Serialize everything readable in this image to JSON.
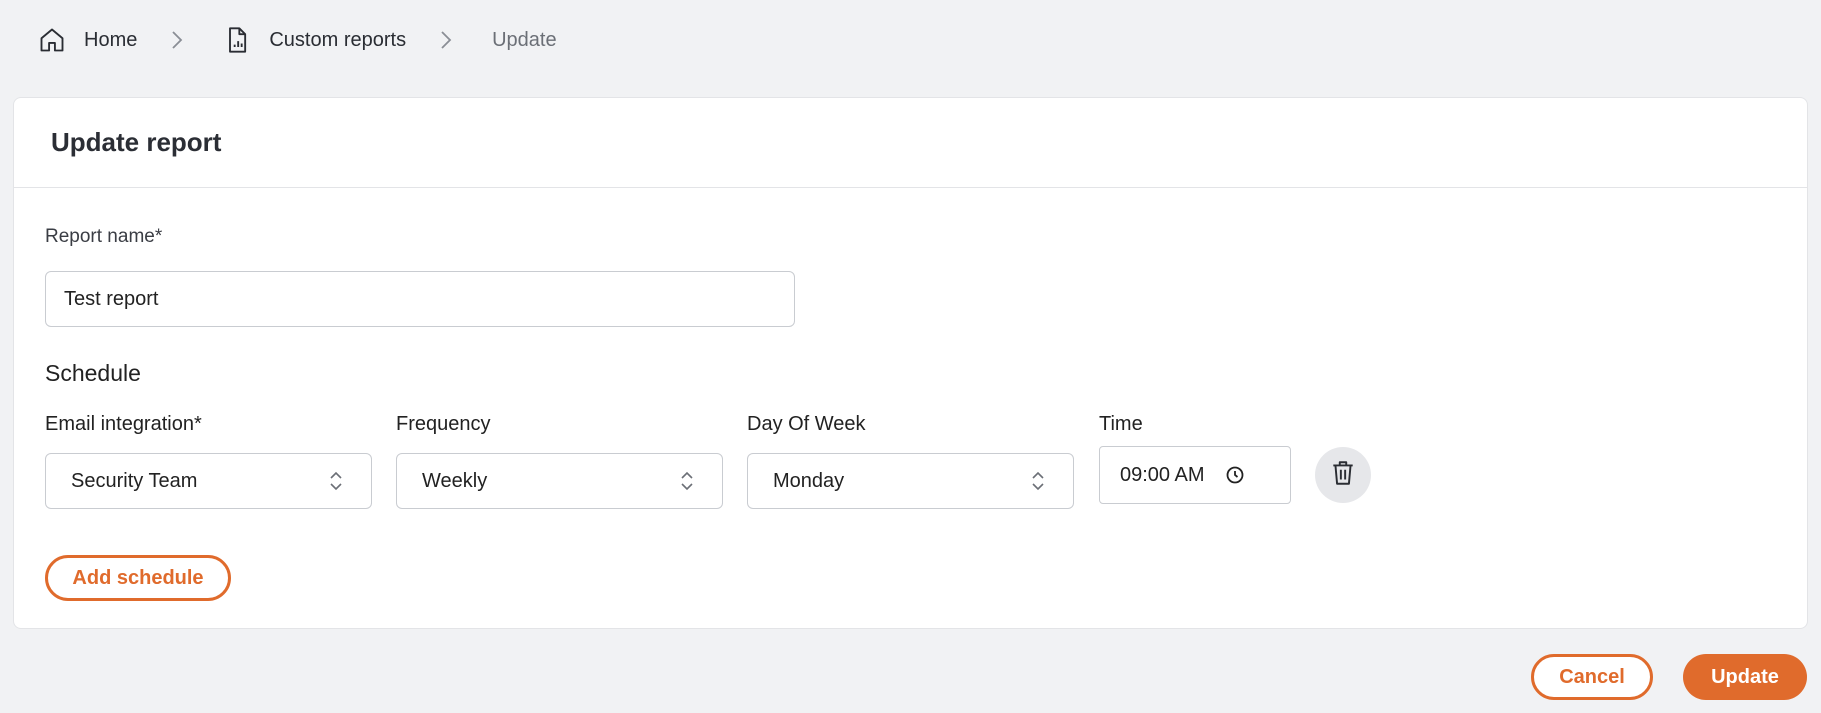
{
  "breadcrumb": {
    "home_label": "Home",
    "reports_label": "Custom reports",
    "current_label": "Update"
  },
  "card": {
    "title": "Update report"
  },
  "form": {
    "report_name_label": "Report name*",
    "report_name_value": "Test report",
    "schedule_title": "Schedule",
    "email_label": "Email integration*",
    "email_value": "Security Team",
    "frequency_label": "Frequency",
    "frequency_value": "Weekly",
    "day_label": "Day Of Week",
    "day_value": "Monday",
    "time_label": "Time",
    "time_value": "09:00 AM",
    "add_schedule_label": "Add schedule"
  },
  "actions": {
    "cancel_label": "Cancel",
    "update_label": "Update"
  },
  "colors": {
    "accent": "#e06b2c",
    "background": "#f1f2f4",
    "border": "#c9ccd1"
  }
}
